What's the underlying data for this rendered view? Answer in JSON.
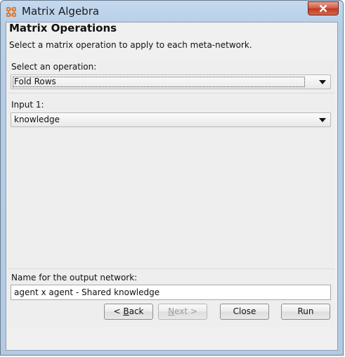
{
  "window": {
    "title": "Matrix Algebra",
    "icon": "grid-network-icon",
    "close_icon": "close-x-icon"
  },
  "header": {
    "title": "Matrix Operations",
    "description": "Select a matrix operation to apply to each meta-network."
  },
  "operation": {
    "label": "Select an operation:",
    "selected": "Fold Rows"
  },
  "input1": {
    "label": "Input 1:",
    "selected": "knowledge"
  },
  "output": {
    "label": "Name for the output network:",
    "value": "agent x agent - Shared knowledge"
  },
  "buttons": {
    "back_prefix": "< ",
    "back_mnemonic": "B",
    "back_rest": "ack",
    "next_mnemonic": "N",
    "next_rest": "ext >",
    "close": "Close",
    "run": "Run"
  },
  "colors": {
    "close_button": "#c9462c",
    "title_icon": "#e07020"
  }
}
